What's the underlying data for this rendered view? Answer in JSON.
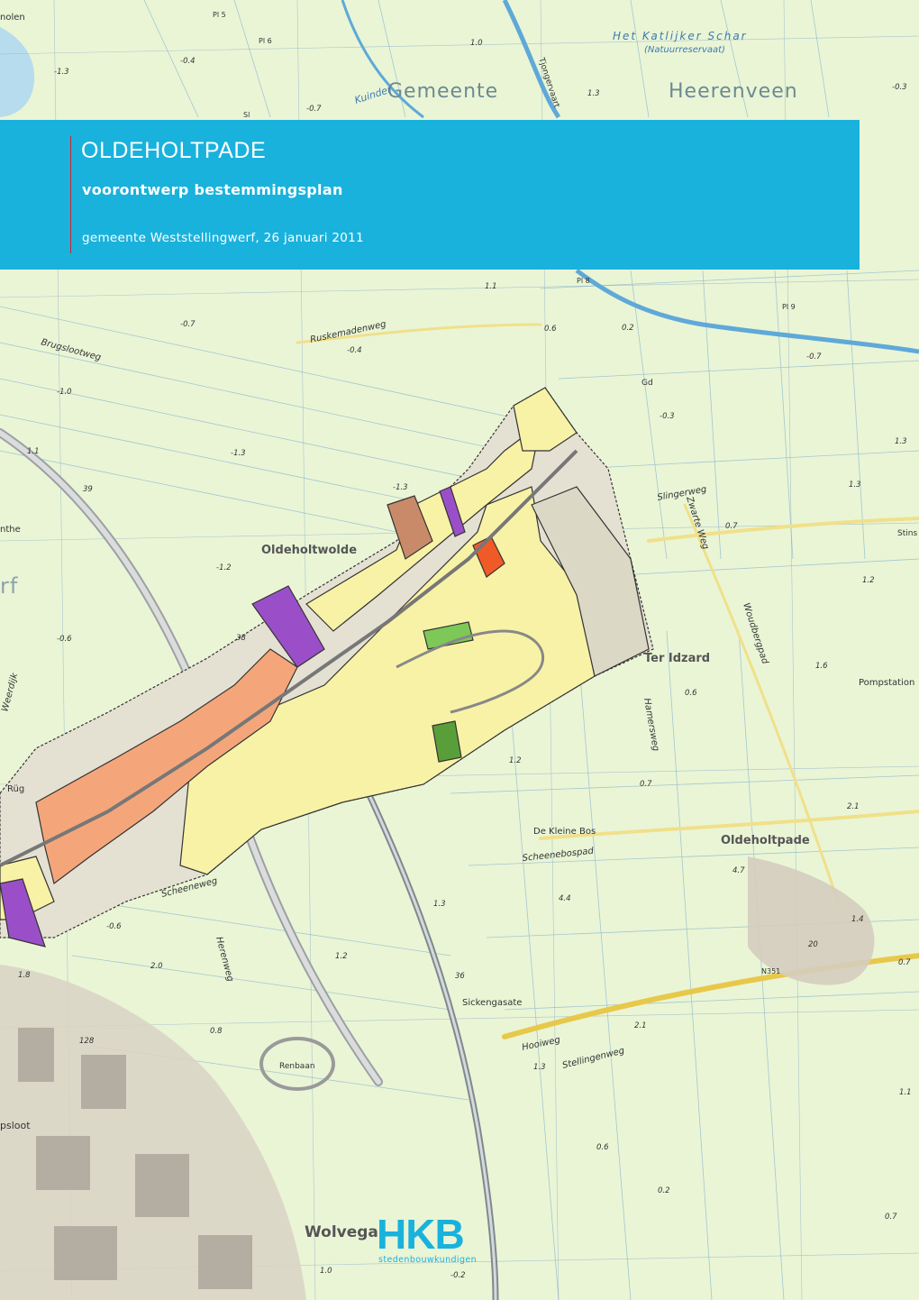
{
  "document": {
    "title": "OLDEHOLTPADE",
    "subtitle": "voorontwerp bestemmingsplan",
    "meta": "gemeente Weststellingwerf, 26 januari 2011"
  },
  "logo": {
    "mark": "HKB",
    "tagline": "stedenbouwkundigen"
  },
  "map": {
    "labels": {
      "top_left": "nolen",
      "nature_reserve": "Het Katlijker Schar",
      "nature_reserve_note": "(Natuurreservaat)",
      "municipality_word": "Gemeente",
      "municipality_name": "Heerenveen",
      "river": "Kuinder",
      "tjonger": "Tjongervaart",
      "ruskemadenweg": "Ruskemadenweg",
      "brugsloot": "Brugslootweg",
      "slingerweg": "Slingerweg",
      "zwarte_weg": "Zwarte Weg",
      "woudbergpad": "Woudbergpad",
      "oldeholtwolde": "Oldeholtwolde",
      "ter_idzard": "Ter Idzard",
      "pompstation": "Pompstation",
      "hamersweg": "Hamersweg",
      "de_kleine_bos": "De Kleine Bos",
      "scheenebospad": "Scheenebospad",
      "oldeholtpade": "Oldeholtpade",
      "scheeneweg": "Scheeneweg",
      "herenweg": "Herenweg",
      "sickengasate": "Sickengasate",
      "hooiweg": "Hooiweg",
      "stellingenweg": "Stellingenweg",
      "renbaan": "Renbaan",
      "wolvega": "Wolvega",
      "stins": "Stins",
      "road_n351": "N351",
      "gd": "Gd",
      "sl": "Sl",
      "pl5": "Pl 5",
      "pl6": "Pl 6",
      "pl8": "Pl 8",
      "pl9": "Pl 9",
      "psloot": "psloot",
      "nthe": "nthe",
      "rf": "rf",
      "weerdijk": "Weerdijk",
      "ruh": "Rüg"
    },
    "heights": [
      "1.0",
      "1.1",
      "-0.4",
      "-1.3",
      "-0.7",
      "1.3",
      "-0.3",
      "-0.7",
      "-0.4",
      "0.6",
      "0.2",
      "-0.7",
      "-1.0",
      "-0.3",
      "-1.3",
      "1.3",
      "1.1",
      "-1.3",
      "0.7",
      "1.3",
      "-1.2",
      "1.2",
      "-0.6",
      "1.6",
      "0.6",
      "1.2",
      "0.7",
      "2.1",
      "4.7",
      "4.4",
      "1.3",
      "1.4",
      "-0.6",
      "2.0",
      "1.2",
      "0.7",
      "1.8",
      "0.8",
      "2.1",
      "1.3",
      "1.1",
      "0.6",
      "0.2",
      "1.0",
      "-0.2",
      "0.7",
      "20",
      "36",
      "38",
      "39",
      "128"
    ]
  }
}
